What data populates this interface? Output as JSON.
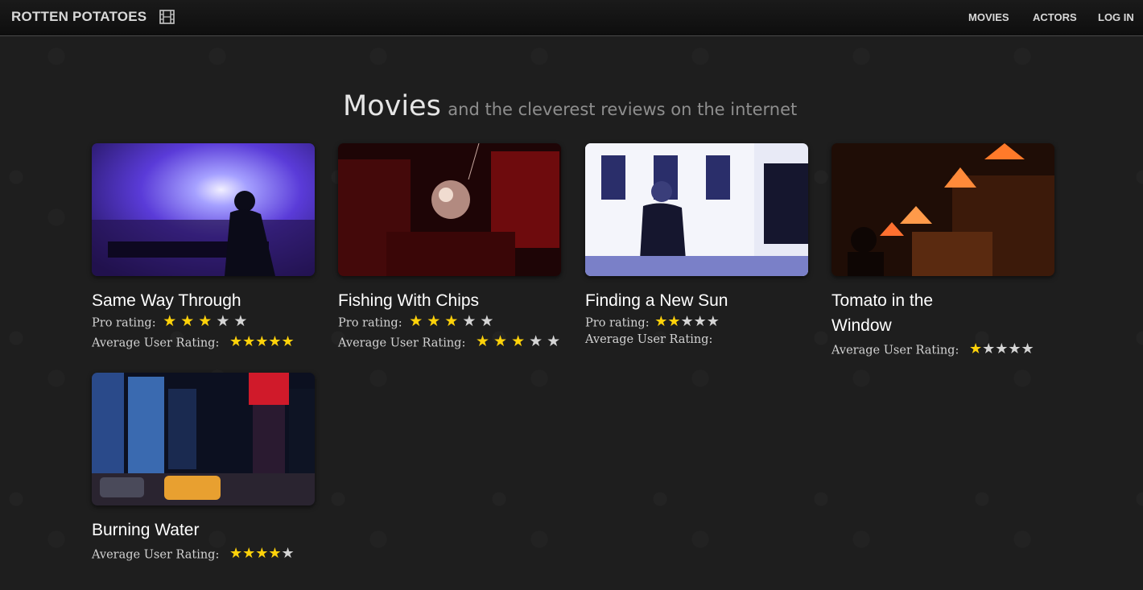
{
  "nav": {
    "brand": "ROTTEN POTATOES",
    "links": [
      "MOVIES",
      "ACTORS",
      "LOG IN"
    ]
  },
  "header": {
    "title": "Movies",
    "subtitle": "and the cleverest reviews on the internet"
  },
  "labels": {
    "pro_rating": "Pro rating:",
    "avg_user_rating": "Average User Rating:"
  },
  "movies": [
    {
      "title": "Same Way Through",
      "pro_rating": 3,
      "user_rating": 5
    },
    {
      "title": "Fishing With Chips",
      "pro_rating": 3,
      "user_rating": 3
    },
    {
      "title": "Finding a New Sun",
      "pro_rating": 2,
      "user_rating": null
    },
    {
      "title": "Tomato in the Window",
      "pro_rating": null,
      "user_rating": 1
    },
    {
      "title": "Burning Water",
      "pro_rating": null,
      "user_rating": 4
    }
  ],
  "colors": {
    "star_on": "#ffd20a",
    "star_off": "#d4d4d4",
    "background": "#1e1e1e"
  }
}
